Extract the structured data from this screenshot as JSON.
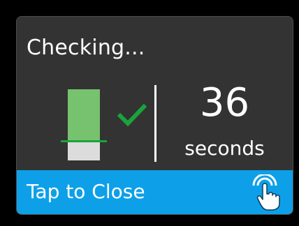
{
  "status": {
    "title": "Checking...",
    "level_fraction": 0.74,
    "result_icon": "checkmark-icon"
  },
  "countdown": {
    "value": "36",
    "unit": "seconds"
  },
  "footer": {
    "label": "Tap to Close",
    "icon": "tap-hand-icon"
  },
  "colors": {
    "background": "#333333",
    "footer": "#0da0e8",
    "level": "#77c26e",
    "check": "#1aa33b",
    "empty": "#dcdcdc"
  }
}
